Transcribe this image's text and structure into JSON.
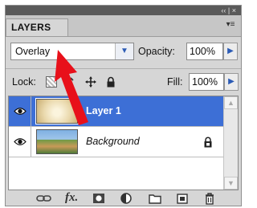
{
  "window": {
    "controls": "‹‹ | ×"
  },
  "panel": {
    "tab_label": "LAYERS",
    "menu_icon": "panel-menu-icon"
  },
  "options": {
    "blend_mode": "Overlay",
    "opacity_label": "Opacity:",
    "opacity_value": "100%",
    "lock_label": "Lock:",
    "fill_label": "Fill:",
    "fill_value": "100%"
  },
  "layers": [
    {
      "name": "Layer 1",
      "selected": true,
      "visible": true
    },
    {
      "name": "Background",
      "selected": false,
      "visible": true,
      "locked": true
    }
  ],
  "bottom_toolbar": {
    "fx_label": "fx."
  },
  "colors": {
    "selection": "#3d6fd6",
    "annotation_arrow": "#e8101a",
    "panel_bg": "#d6d6d6"
  }
}
